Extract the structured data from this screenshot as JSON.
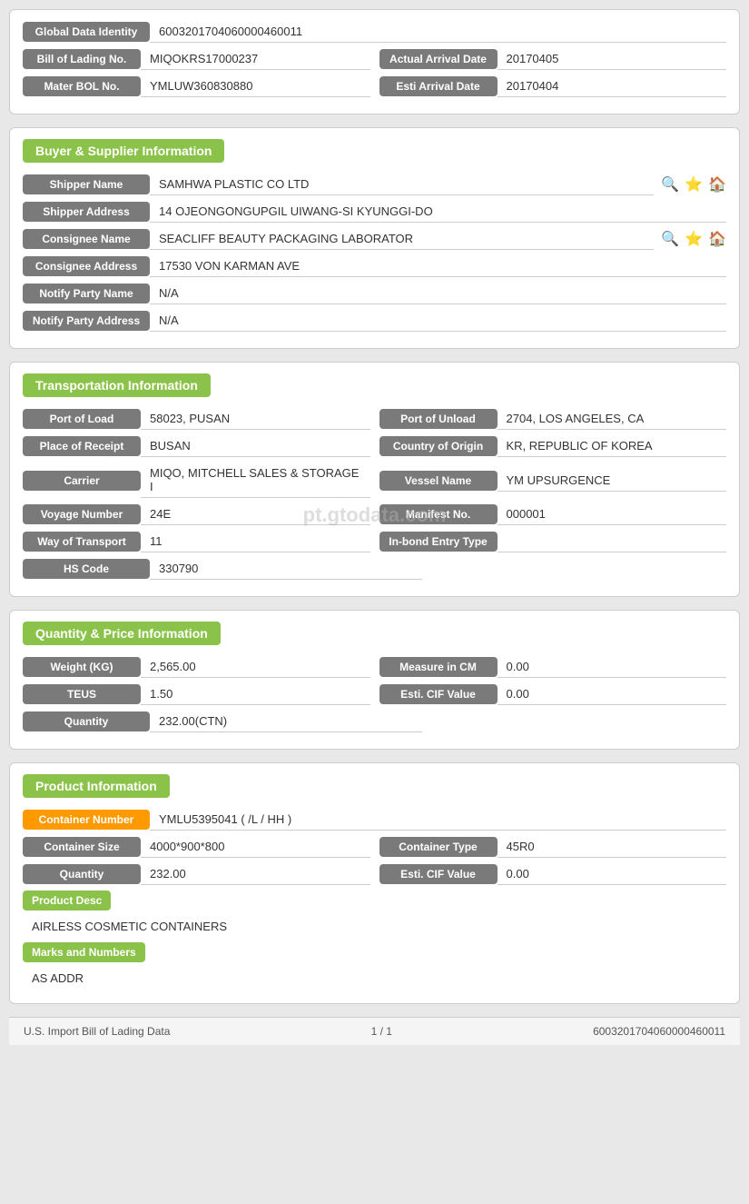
{
  "top": {
    "global_data_identity_label": "Global Data Identity",
    "global_data_identity_value": "6003201704060000460011",
    "bill_of_lading_label": "Bill of Lading No.",
    "bill_of_lading_value": "MIQOKRS17000237",
    "actual_arrival_date_label": "Actual Arrival Date",
    "actual_arrival_date_value": "20170405",
    "master_bol_label": "Mater BOL No.",
    "master_bol_value": "YMLUW360830880",
    "esti_arrival_date_label": "Esti Arrival Date",
    "esti_arrival_date_value": "20170404"
  },
  "buyer_supplier": {
    "section_title": "Buyer & Supplier Information",
    "shipper_name_label": "Shipper Name",
    "shipper_name_value": "SAMHWA PLASTIC CO LTD",
    "shipper_address_label": "Shipper Address",
    "shipper_address_value": "14 OJEONGONGUPGIL UIWANG-SI KYUNGGI-DO",
    "consignee_name_label": "Consignee Name",
    "consignee_name_value": "SEACLIFF BEAUTY PACKAGING LABORATOR",
    "consignee_address_label": "Consignee Address",
    "consignee_address_value": "17530 VON KARMAN AVE",
    "notify_party_name_label": "Notify Party Name",
    "notify_party_name_value": "N/A",
    "notify_party_address_label": "Notify Party Address",
    "notify_party_address_value": "N/A"
  },
  "transportation": {
    "section_title": "Transportation Information",
    "port_of_load_label": "Port of Load",
    "port_of_load_value": "58023, PUSAN",
    "port_of_unload_label": "Port of Unload",
    "port_of_unload_value": "2704, LOS ANGELES, CA",
    "place_of_receipt_label": "Place of Receipt",
    "place_of_receipt_value": "BUSAN",
    "country_of_origin_label": "Country of Origin",
    "country_of_origin_value": "KR, REPUBLIC OF KOREA",
    "carrier_label": "Carrier",
    "carrier_value": "MIQO, MITCHELL SALES & STORAGE I",
    "vessel_name_label": "Vessel Name",
    "vessel_name_value": "YM UPSURGENCE",
    "voyage_number_label": "Voyage Number",
    "voyage_number_value": "24E",
    "manifest_no_label": "Manifest No.",
    "manifest_no_value": "000001",
    "way_of_transport_label": "Way of Transport",
    "way_of_transport_value": "11",
    "in_bond_entry_type_label": "In-bond Entry Type",
    "in_bond_entry_type_value": "",
    "hs_code_label": "HS Code",
    "hs_code_value": "330790",
    "watermark": "pt.gtodata.com"
  },
  "quantity_price": {
    "section_title": "Quantity & Price Information",
    "weight_kg_label": "Weight (KG)",
    "weight_kg_value": "2,565.00",
    "measure_in_cm_label": "Measure in CM",
    "measure_in_cm_value": "0.00",
    "teus_label": "TEUS",
    "teus_value": "1.50",
    "esti_cif_value_label": "Esti. CIF Value",
    "esti_cif_value_value": "0.00",
    "quantity_label": "Quantity",
    "quantity_value": "232.00(CTN)"
  },
  "product": {
    "section_title": "Product Information",
    "container_number_label": "Container Number",
    "container_number_value": "YMLU5395041 ( /L / HH )",
    "container_size_label": "Container Size",
    "container_size_value": "4000*900*800",
    "container_type_label": "Container Type",
    "container_type_value": "45R0",
    "quantity_label": "Quantity",
    "quantity_value": "232.00",
    "esti_cif_value_label": "Esti. CIF Value",
    "esti_cif_value_value": "0.00",
    "product_desc_label": "Product Desc",
    "product_desc_value": "AIRLESS COSMETIC CONTAINERS",
    "marks_and_numbers_label": "Marks and Numbers",
    "marks_and_numbers_value": "AS ADDR"
  },
  "footer": {
    "left": "U.S. Import Bill of Lading Data",
    "center": "1 / 1",
    "right": "6003201704060000460011"
  }
}
